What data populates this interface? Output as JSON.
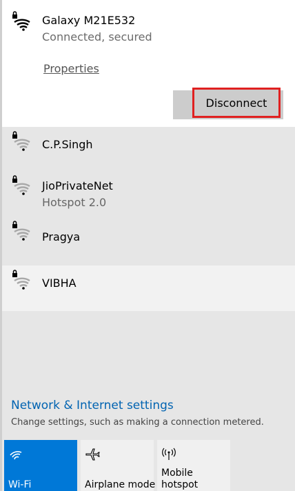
{
  "connected": {
    "name": "Galaxy M21E532",
    "status": "Connected, secured",
    "properties_label": "Properties",
    "disconnect_label": "Disconnect"
  },
  "networks": [
    {
      "name": "C.P.Singh",
      "sub": ""
    },
    {
      "name": "JioPrivateNet",
      "sub": "Hotspot 2.0"
    },
    {
      "name": "Pragya",
      "sub": ""
    },
    {
      "name": "VIBHA",
      "sub": ""
    }
  ],
  "settings": {
    "link_label": "Network & Internet settings",
    "description": "Change settings, such as making a connection metered."
  },
  "quick_actions": [
    {
      "label": "Wi-Fi",
      "icon": "wifi-icon",
      "active": true
    },
    {
      "label": "Airplane mode",
      "icon": "airplane-icon",
      "active": false
    },
    {
      "label": "Mobile\nhotspot",
      "icon": "hotspot-icon",
      "active": false
    }
  ],
  "colors": {
    "accent": "#0078d7",
    "link": "#0063b1",
    "highlight_border": "#e02020"
  }
}
